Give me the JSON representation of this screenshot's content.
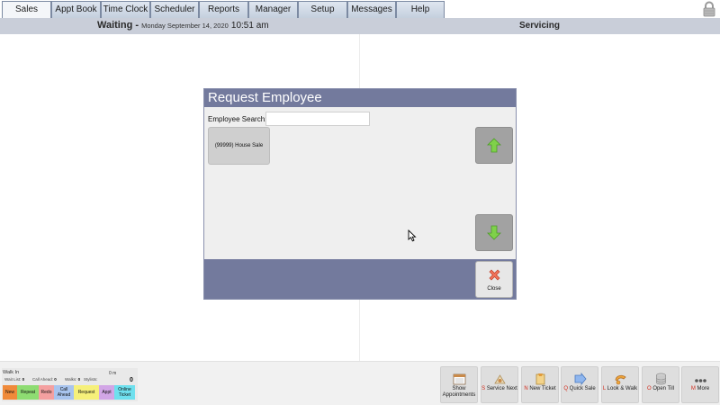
{
  "tabs": [
    {
      "label": "Sales",
      "active": true
    },
    {
      "label": "Appt Book",
      "active": false
    },
    {
      "label": "Time Clock",
      "active": false
    },
    {
      "label": "Scheduler",
      "active": false
    },
    {
      "label": "Reports",
      "active": false
    },
    {
      "label": "Manager",
      "active": false
    },
    {
      "label": "Setup",
      "active": false
    },
    {
      "label": "Messages",
      "active": false
    },
    {
      "label": "Help",
      "active": false
    }
  ],
  "header": {
    "waiting_label": "Waiting -",
    "date": "Monday September 14, 2020",
    "time": "10:51 am",
    "servicing_label": "Servicing"
  },
  "modal": {
    "title": "Request Employee",
    "search_label": "Employee Search:",
    "search_value": "",
    "employees": [
      "(99999) House Sale"
    ],
    "close_label": "Close"
  },
  "walk_in": {
    "label": "Walk In",
    "wait_list_label": "Wait List:",
    "wait_list": "0",
    "call_ahead_label": "Call Ahead:",
    "call_ahead": "0",
    "walks_label": "Walks:",
    "walks": "0",
    "stylists_label": "Stylists:",
    "minutes": "0 m",
    "count": "0",
    "chips": [
      {
        "label": "New",
        "color": "#f08a3a"
      },
      {
        "label": "Repeat",
        "color": "#8edc72"
      },
      {
        "label": "Redo",
        "color": "#f4a0a0"
      },
      {
        "label": "Call Ahead",
        "color": "#a8c4ee"
      },
      {
        "label": "Request",
        "color": "#f6f07a"
      },
      {
        "label": "Appt",
        "color": "#d2a6e6"
      },
      {
        "label": "Online Ticket",
        "color": "#6ee0ee"
      }
    ]
  },
  "actions": [
    {
      "key": "",
      "label": "Show Appointments",
      "icon": "calendar-icon"
    },
    {
      "key": "S",
      "label": "Service Next",
      "icon": "service-next-icon"
    },
    {
      "key": "N",
      "label": "New Ticket",
      "icon": "new-ticket-icon"
    },
    {
      "key": "Q",
      "label": "Quick Sale",
      "icon": "quick-sale-icon"
    },
    {
      "key": "L",
      "label": "Look & Walk",
      "icon": "look-walk-icon"
    },
    {
      "key": "O",
      "label": "Open Till",
      "icon": "coins-icon"
    },
    {
      "key": "M",
      "label": "More",
      "icon": "more-icon"
    }
  ],
  "colors": {
    "modal_header": "#737a9d",
    "tab_border": "#7c8aa2",
    "hotkey": "#d12a1a"
  }
}
